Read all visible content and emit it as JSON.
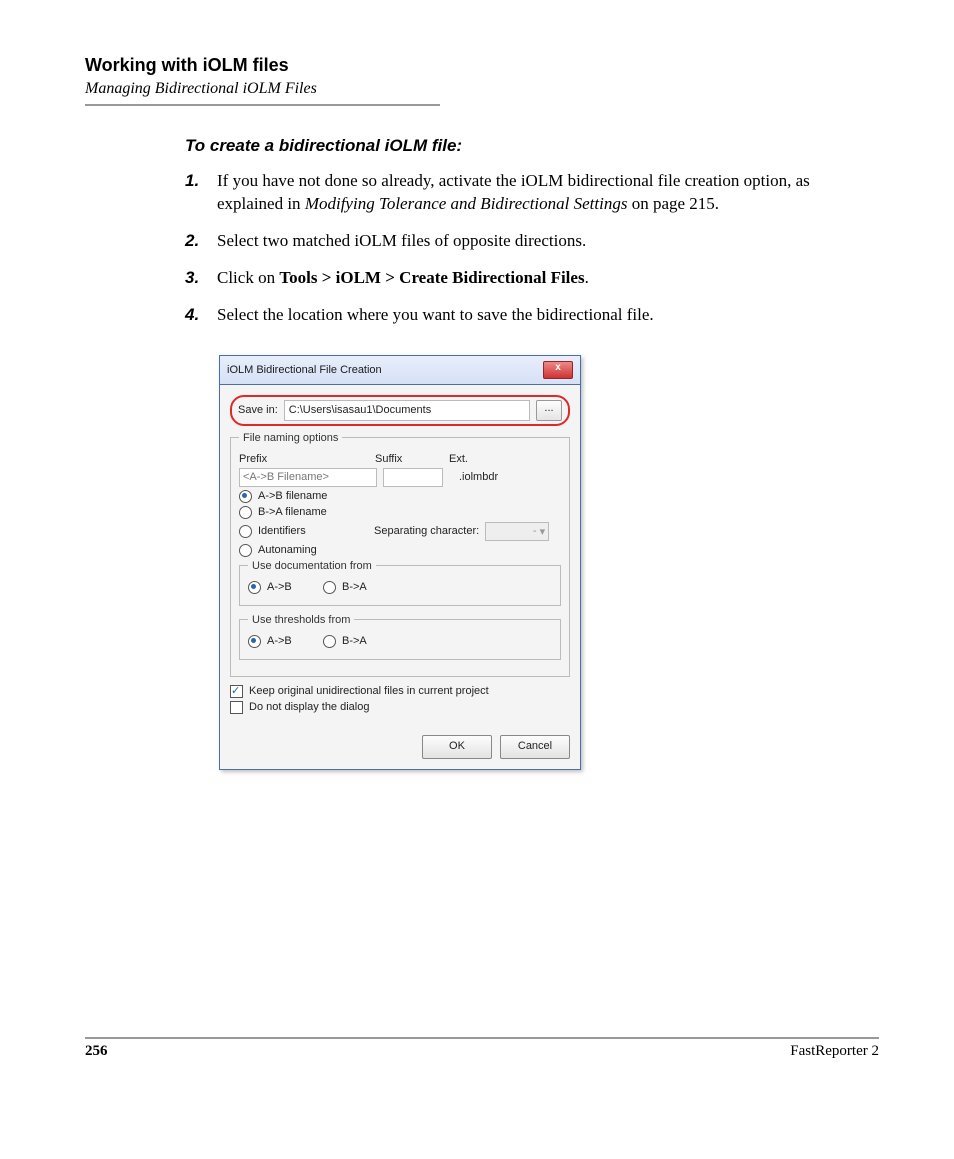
{
  "header": {
    "title": "Working with iOLM files",
    "subtitle": "Managing Bidirectional iOLM Files"
  },
  "section_title": "To create a bidirectional iOLM file:",
  "steps": [
    {
      "num": "1.",
      "pre": "If you have not done so already, activate the iOLM bidirectional file creation option, as explained in ",
      "italic": "Modifying Tolerance and Bidirectional Settings",
      "post": " on page 215."
    },
    {
      "num": "2.",
      "pre": "Select two matched iOLM files of opposite directions.",
      "italic": "",
      "post": ""
    },
    {
      "num": "3.",
      "pre": "Click on ",
      "bold": "Tools > iOLM > Create Bidirectional Files",
      "post": "."
    },
    {
      "num": "4.",
      "pre": "Select the location where you want to save the bidirectional file.",
      "italic": "",
      "post": ""
    }
  ],
  "dialog": {
    "title": "iOLM Bidirectional File Creation",
    "close_x": "x",
    "save_in_label": "Save in:",
    "save_in_path": "C:\\Users\\isasau1\\Documents",
    "browse": "...",
    "file_naming_legend": "File naming options",
    "prefix_label": "Prefix",
    "suffix_label": "Suffix",
    "ext_label": "Ext.",
    "prefix_value": "<A->B Filename>",
    "suffix_value": "",
    "ext_value": ".iolmbdr",
    "radios": {
      "ab_filename": "A->B filename",
      "ba_filename": "B->A filename",
      "identifiers": "Identifiers",
      "autonaming": "Autonaming"
    },
    "sep_label": "Separating character:",
    "sep_value": "-",
    "doc_legend": "Use documentation from",
    "thresh_legend": "Use thresholds from",
    "ab": "A->B",
    "ba": "B->A",
    "keep_original": "Keep original unidirectional files in current project",
    "do_not_display": "Do not display the dialog",
    "ok": "OK",
    "cancel": "Cancel"
  },
  "footer": {
    "page": "256",
    "product": "FastReporter 2"
  }
}
